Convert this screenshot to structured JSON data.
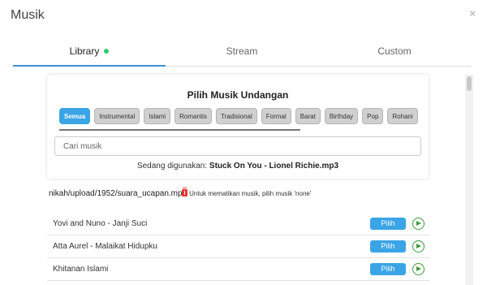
{
  "modal": {
    "title": "Musik",
    "close_glyph": "×",
    "close_icon": "close-icon"
  },
  "tabs": [
    {
      "label": "Library",
      "active": true,
      "status_dot_color": "#2ecc71"
    },
    {
      "label": "Stream",
      "active": false
    },
    {
      "label": "Custom",
      "active": false
    }
  ],
  "picker": {
    "title": "Pilih Musik Undangan",
    "categories": [
      {
        "label": "Semua",
        "active": true
      },
      {
        "label": "Instrumental",
        "active": false
      },
      {
        "label": "Islami",
        "active": false
      },
      {
        "label": "Romantis",
        "active": false
      },
      {
        "label": "Tradisional",
        "active": false
      },
      {
        "label": "Formal",
        "active": false
      },
      {
        "label": "Barat",
        "active": false
      },
      {
        "label": "Birthday",
        "active": false
      },
      {
        "label": "Pop",
        "active": false
      },
      {
        "label": "Rohani",
        "active": false
      }
    ],
    "search_placeholder": "Cari musik",
    "now_playing_label": "Sedang digunakan:",
    "now_playing_value": "Stuck On You - Lionel Richie.mp3"
  },
  "upload": {
    "path": "nikah/upload/1952/suara_ucapan.mp3",
    "delete_icon": "trash-icon",
    "mute_note": "Untuk mematikan musik, pilih musik 'none'"
  },
  "songs": [
    {
      "title": "Yovi and Nuno - Janji Suci",
      "pick_label": "Pilih"
    },
    {
      "title": "Atta Aurel - Malaikat Hidupku",
      "pick_label": "Pilih"
    },
    {
      "title": "Khitanan Islami",
      "pick_label": "Pilih"
    }
  ],
  "colors": {
    "accent": "#3ba4e6",
    "play": "#3a9a3a",
    "delete": "#e53935"
  }
}
